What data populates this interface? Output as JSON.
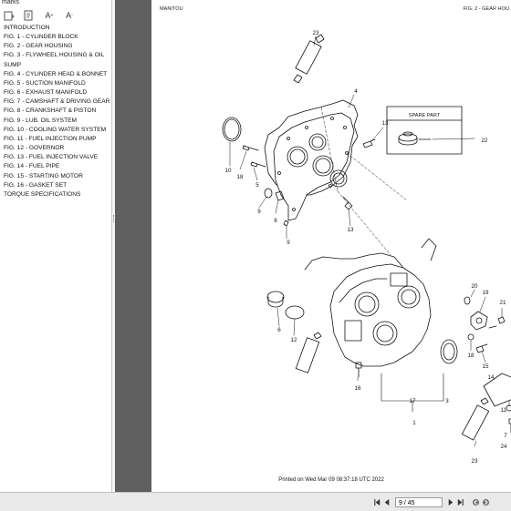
{
  "sidebar": {
    "title": "marks",
    "tools": [
      {
        "icon": "bookmark-options-icon"
      },
      {
        "icon": "expand-bookmark-icon"
      },
      {
        "icon": "text-size-increase-icon",
        "label": "A"
      },
      {
        "icon": "text-size-decrease-icon",
        "label": "A"
      }
    ],
    "items": [
      {
        "label": "INTRODUCTION"
      },
      {
        "label": "FIG. 1 - CYLINDER BLOCK"
      },
      {
        "label": "FIG. 2 - GEAR HOUSING"
      },
      {
        "label": "FIG. 3 - FLYWHEEL HOUSING & OIL SUMP"
      },
      {
        "label": "FIG. 4 - CYLINDER HEAD & BONNET"
      },
      {
        "label": "FIG. 5 - SUCTION MANIFOLD"
      },
      {
        "label": "FIG. 6 - EXHAUST MANIFOLD"
      },
      {
        "label": "FIG. 7 - CAMSHAFT & DRIVING GEAR"
      },
      {
        "label": "FIG. 8 - CRANKSHAFT & PISTON"
      },
      {
        "label": "FIG. 9 - LUB. OIL SYSTEM"
      },
      {
        "label": "FIG. 10 - COOLING WATER SYSTEM"
      },
      {
        "label": "FIG. 11 - FUEL INJECTION PUMP"
      },
      {
        "label": "FIG. 12 - GOVERNOR"
      },
      {
        "label": "FIG. 13 - FUEL INJECTION VALVE"
      },
      {
        "label": "FIG. 14 - FUEL PIPE"
      },
      {
        "label": "FIG. 15 - STARTING MOTOR"
      },
      {
        "label": "FIG. 16 - GASKET SET"
      },
      {
        "label": "TORQUE SPECIFICATIONS"
      }
    ]
  },
  "page": {
    "header_left": "MANITOU",
    "header_right": "FIG. 2 - GEAR HOU",
    "spare_part_title": "SPARE PART",
    "footer": "Printed on  Wed Mar 09 08:37:18 UTC 2022",
    "callouts": [
      "23",
      "4",
      "13",
      "10",
      "18",
      "5",
      "9",
      "8",
      "9",
      "13",
      "22",
      "20",
      "19",
      "21",
      "6",
      "12",
      "16",
      "17",
      "3",
      "18",
      "15",
      "14",
      "7",
      "1",
      "23",
      "24",
      "11"
    ]
  },
  "toolbar": {
    "page_indicator": "9 / 45"
  }
}
